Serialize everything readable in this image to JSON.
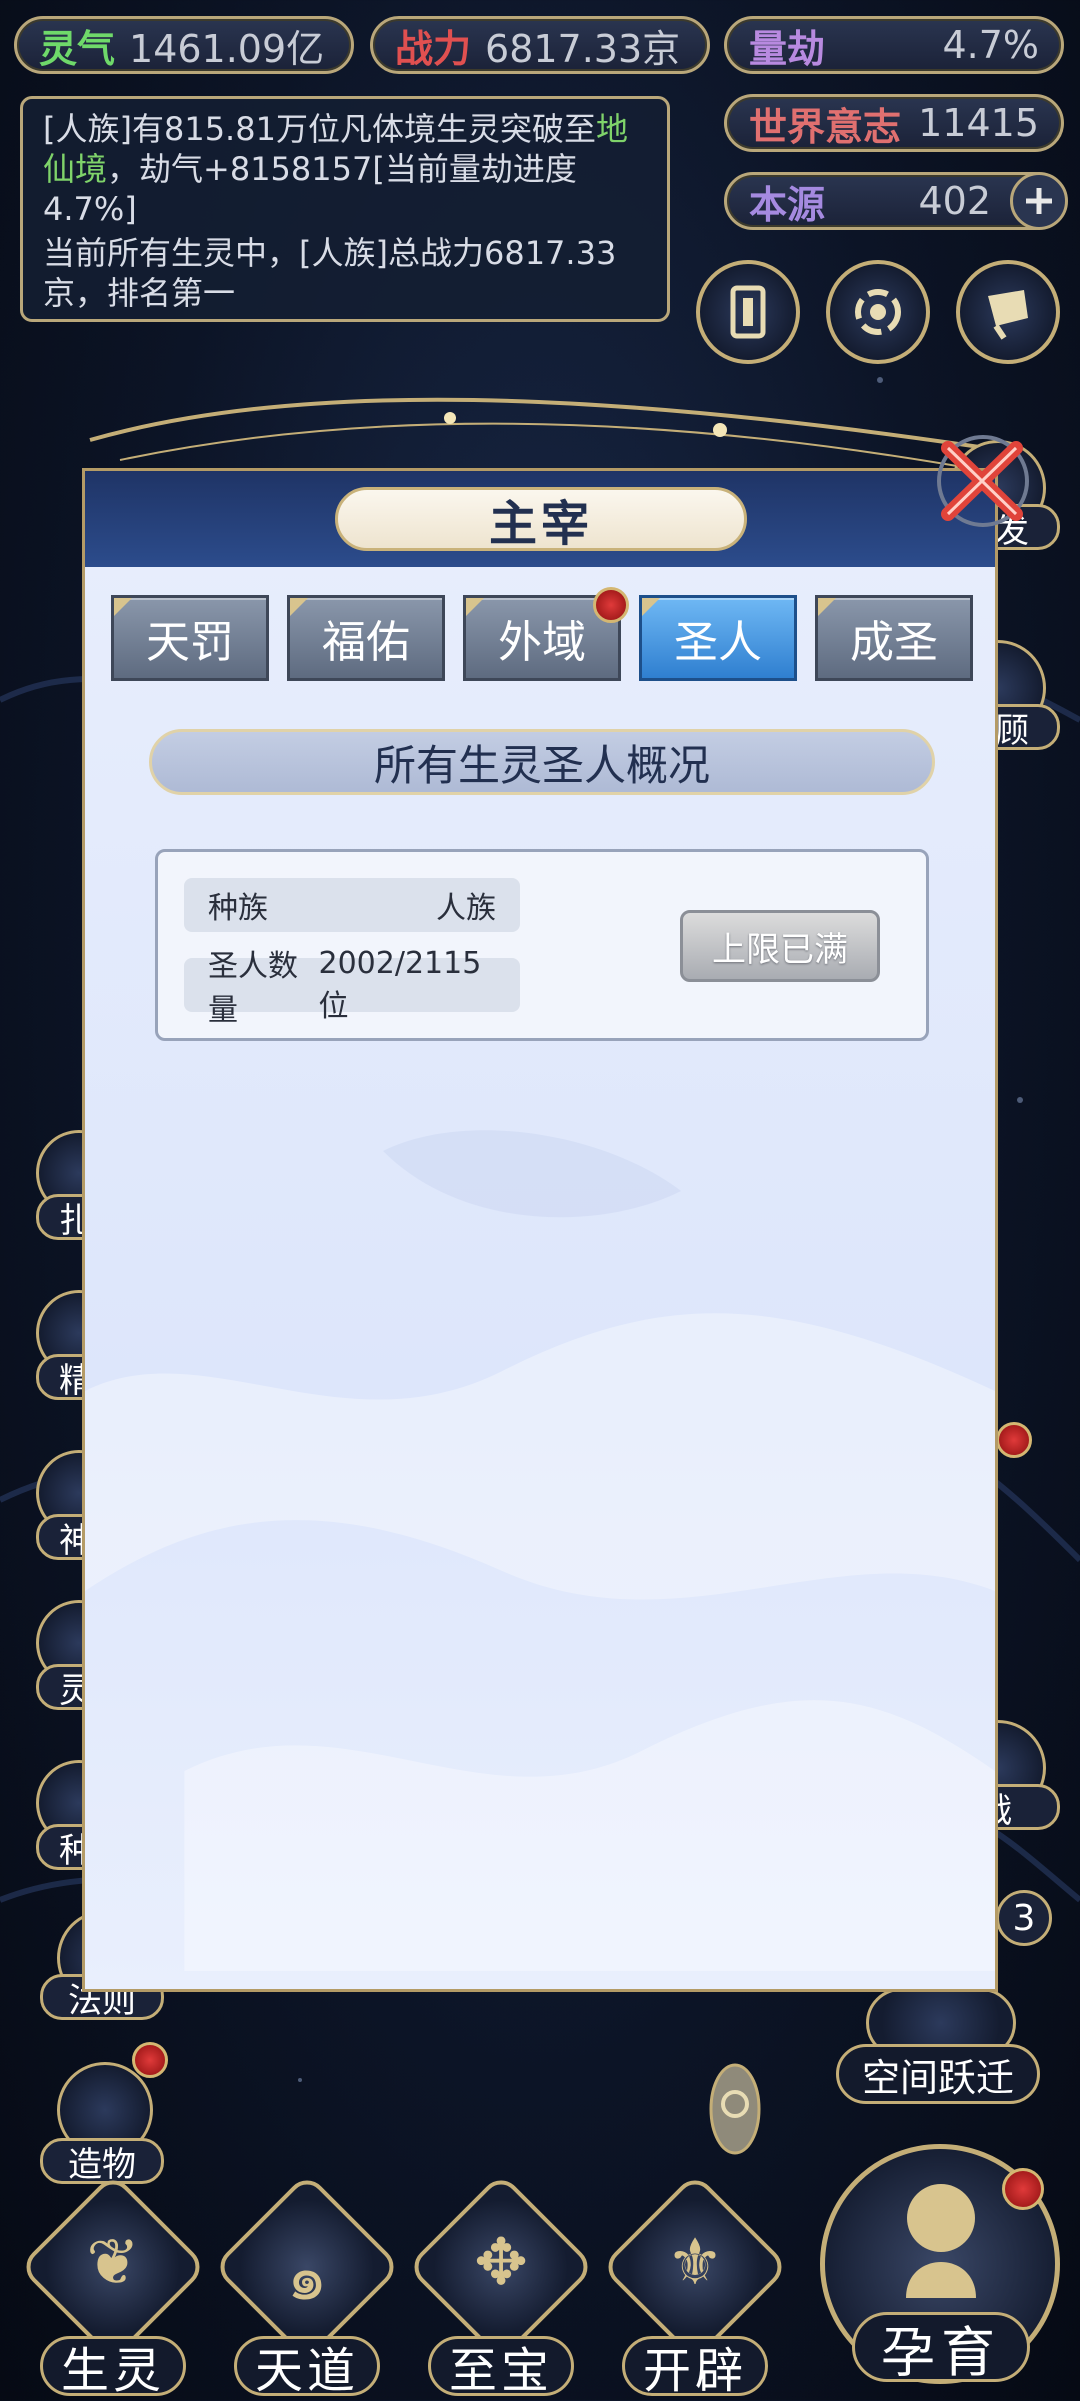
{
  "resources": {
    "lingqi": {
      "label": "灵气",
      "value": "1461.09亿"
    },
    "zhanli": {
      "label": "战力",
      "value": "6817.33京"
    },
    "liangjie": {
      "label": "量劫",
      "value": "4.7%"
    },
    "shijie": {
      "label": "世界意志",
      "value": "11415"
    },
    "benyuan": {
      "label": "本源",
      "value": "402"
    }
  },
  "message": {
    "line1_prefix": "[人族]有815.81万位凡体境生灵突破至",
    "line1_green": "地仙境",
    "line1_suffix": "，劫气+8158157[当前量劫进度4.7%]",
    "line2": "当前所有生灵中，[人族]总战力6817.33京，排名第一"
  },
  "side_right": {
    "bao_fa": "爆发",
    "hui_gu": "眷顾",
    "zhan": "战",
    "badge_num": "3",
    "space_jump": "空间跃迁"
  },
  "side_left": {
    "fa_ze": "法则",
    "zao_wu": "造物",
    "partial": [
      "扎",
      "精",
      "神",
      "灵",
      "种"
    ]
  },
  "nav": [
    "生灵",
    "天道",
    "至宝",
    "开辟"
  ],
  "nav_main": "孕育",
  "modal": {
    "title": "主宰",
    "tabs": [
      "天罚",
      "福佑",
      "外域",
      "圣人",
      "成圣"
    ],
    "active_tab": 3,
    "section_title": "所有生灵圣人概况",
    "card": {
      "race_label": "种族",
      "race_value": "人族",
      "count_label": "圣人数量",
      "count_value": "2002/2115位",
      "button": "上限已满"
    }
  },
  "colors": {
    "accent_gold": "#c4ae77",
    "tab_active": "#2f7fd0",
    "notice_red": "#e03a3a",
    "green_text": "#7fd36a"
  }
}
